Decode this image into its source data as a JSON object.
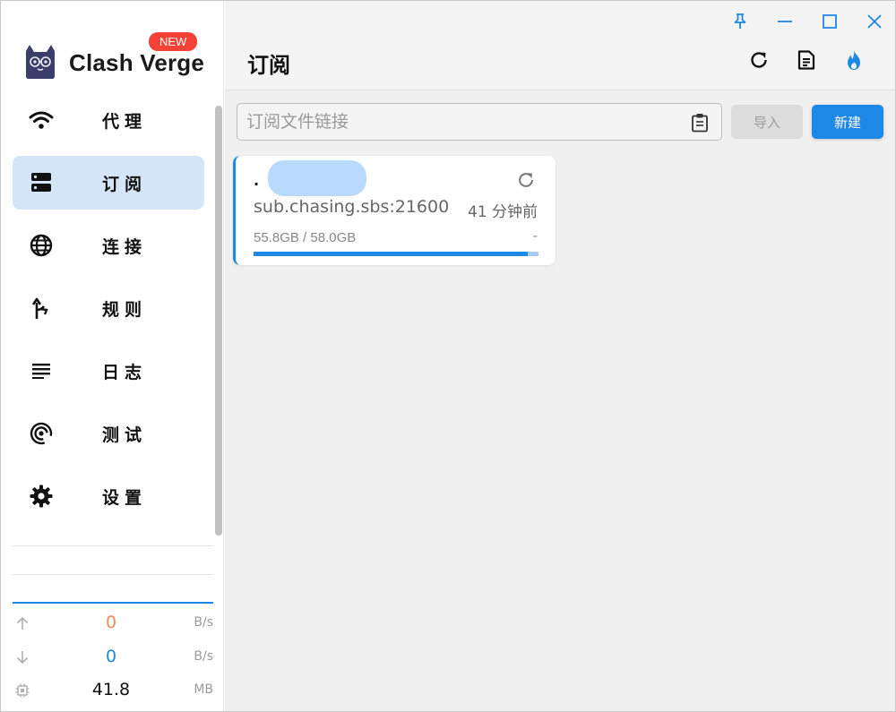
{
  "app": {
    "name": "Clash Verge",
    "badge": "NEW"
  },
  "sidebar": {
    "items": [
      {
        "id": "proxy",
        "label": "代理",
        "icon": "wifi-icon",
        "active": false
      },
      {
        "id": "profiles",
        "label": "订阅",
        "icon": "server-icon",
        "active": true
      },
      {
        "id": "connections",
        "label": "连接",
        "icon": "globe-icon",
        "active": false
      },
      {
        "id": "rules",
        "label": "规则",
        "icon": "fork-arrow-icon",
        "active": false
      },
      {
        "id": "logs",
        "label": "日志",
        "icon": "lines-icon",
        "active": false
      },
      {
        "id": "test",
        "label": "测试",
        "icon": "broadcast-icon",
        "active": false
      },
      {
        "id": "settings",
        "label": "设置",
        "icon": "gear-icon",
        "active": false
      }
    ]
  },
  "traffic": {
    "up_value": "0",
    "up_unit": "B/s",
    "down_value": "0",
    "down_unit": "B/s",
    "mem_value": "41.8",
    "mem_unit": "MB",
    "colors": {
      "up": "#ef8a5b",
      "down": "#1e88e5",
      "mem": "#111111"
    }
  },
  "header": {
    "title": "订阅"
  },
  "import_bar": {
    "placeholder": "订阅文件链接",
    "value": "",
    "import_label": "导入",
    "new_label": "新建"
  },
  "profiles": [
    {
      "name": "·",
      "host": "sub.chasing.sbs:21600",
      "updated": "41 分钟前",
      "usage": "55.8GB / 58.0GB",
      "expire": "-",
      "used_fraction": 0.962,
      "selected": true
    }
  ],
  "colors": {
    "accent": "#1e88e5",
    "active_nav_bg": "#d4e5f8",
    "badge": "#f44336"
  }
}
